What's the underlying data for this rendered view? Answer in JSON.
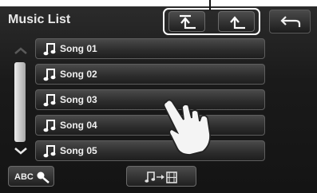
{
  "header": {
    "title": "Music List"
  },
  "nav": {
    "top_level_icon": "return-to-top-arrow-icon",
    "up_level_icon": "up-one-level-arrow-icon",
    "back_icon": "back-arrow-icon"
  },
  "list": {
    "items": [
      {
        "label": "Song 01",
        "icon": "music-note-icon"
      },
      {
        "label": "Song 02",
        "icon": "music-note-icon"
      },
      {
        "label": "Song 03",
        "icon": "music-note-icon"
      },
      {
        "label": "Song 04",
        "icon": "music-note-icon"
      },
      {
        "label": "Song 05",
        "icon": "music-note-icon"
      }
    ],
    "scroll_up_icon": "chevron-up-icon",
    "scroll_down_icon": "chevron-down-icon"
  },
  "footer": {
    "abc_label": "ABC",
    "abc_icon": "search-icon",
    "convert_icon": "music-to-video-icon"
  },
  "colors": {
    "frame": "#ffffff",
    "background": "#1a1a1a",
    "text": "#f0f0f0"
  }
}
